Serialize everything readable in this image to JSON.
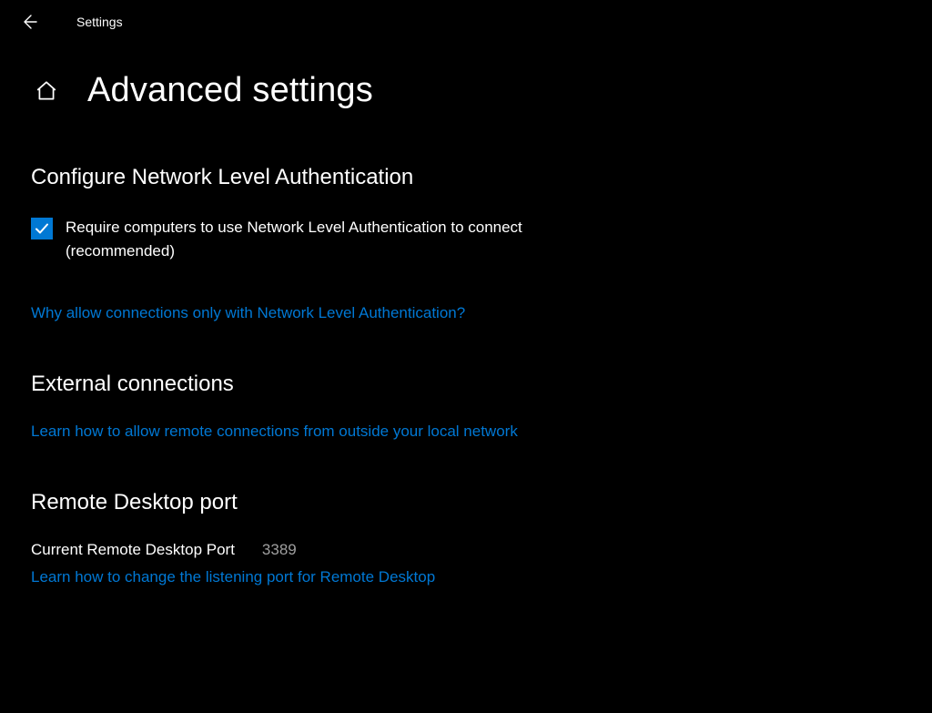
{
  "titlebar": {
    "app_name": "Settings"
  },
  "page": {
    "title": "Advanced settings"
  },
  "sections": {
    "nla": {
      "heading": "Configure Network Level Authentication",
      "checkbox_label": "Require computers to use Network Level Authentication to connect (recommended)",
      "link": "Why allow connections only with Network Level Authentication?"
    },
    "external": {
      "heading": "External connections",
      "link": "Learn how to allow remote connections from outside your local network"
    },
    "port": {
      "heading": "Remote Desktop port",
      "label": "Current Remote Desktop Port",
      "value": "3389",
      "link": "Learn how to change the listening port for Remote Desktop"
    }
  }
}
